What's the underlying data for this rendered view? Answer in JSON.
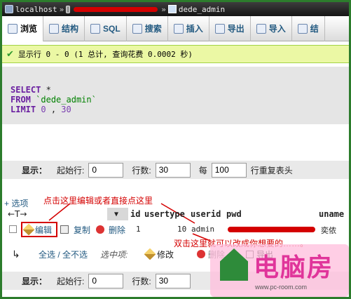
{
  "breadcrumb": {
    "server": "localhost",
    "separator": "»",
    "table": "dede_admin"
  },
  "tabs": [
    {
      "label": "浏览",
      "icon": "browse-icon"
    },
    {
      "label": "结构",
      "icon": "structure-icon"
    },
    {
      "label": "SQL",
      "icon": "sql-icon"
    },
    {
      "label": "搜索",
      "icon": "search-icon"
    },
    {
      "label": "插入",
      "icon": "insert-icon"
    },
    {
      "label": "导出",
      "icon": "export-icon"
    },
    {
      "label": "导入",
      "icon": "import-icon"
    },
    {
      "label": "结",
      "icon": "structure-icon"
    }
  ],
  "success": {
    "text": "显示行 0 - 0 (1 总计, 查询花费 0.0002 秒)"
  },
  "sql": {
    "select": "SELECT",
    "star": "*",
    "from": "FROM",
    "table": "`dede_admin`",
    "limit": "LIMIT",
    "offset": "0",
    "comma": ",",
    "count": "30"
  },
  "nav_top": {
    "show_label": "显示：",
    "start_label": "起始行:",
    "start_value": "0",
    "rows_label": "行数:",
    "rows_value": "30",
    "every_label": "每",
    "repeat_value": "100",
    "repeat_label": "行重复表头"
  },
  "options_link": "+ 选项",
  "annotation_edit": "点击这里编辑或者直接点这里",
  "table": {
    "columns": [
      "id",
      "usertype",
      "userid",
      "pwd",
      "uname"
    ],
    "row": {
      "edit": "编辑",
      "copy": "复制",
      "delete": "删除",
      "id": "1",
      "usertype": "10",
      "userid": "admin",
      "uname": "奕侬"
    }
  },
  "annotation_dblclick": "双击这里就可以改成你想要的……。",
  "bulk": {
    "select_all": "全选",
    "slash": "/",
    "deselect_all": "全不选",
    "with_selected": "选中项:",
    "edit": "修改",
    "delete": "删除",
    "export": "导出"
  },
  "nav_bottom": {
    "show_label": "显示：",
    "start_label": "起始行:",
    "start_value": "0",
    "rows_label": "行数:",
    "rows_value": "30"
  },
  "watermark": {
    "brand": "电脑房",
    "url": "www.pc-room.com"
  },
  "colors": {
    "frame": "#2c7c2c",
    "success_bg": "#ebf8a4",
    "annotation": "#d40000",
    "link": "#235a81"
  }
}
